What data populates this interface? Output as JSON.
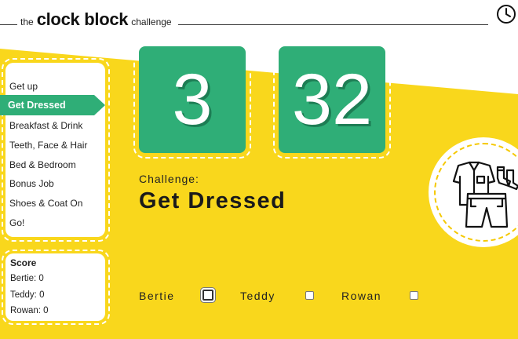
{
  "header": {
    "brand_prefix": "the",
    "brand_main": "clock block",
    "brand_suffix": "challenge",
    "clock_icon": "clock-icon"
  },
  "colors": {
    "yellow": "#f9d71c",
    "green": "#2fae77",
    "green_shadow": "#1d7d54",
    "white": "#ffffff"
  },
  "menu": {
    "items": [
      {
        "label": "Get up",
        "active": false
      },
      {
        "label": "Get Dressed",
        "active": true
      },
      {
        "label": "Breakfast & Drink",
        "active": false
      },
      {
        "label": "Teeth, Face & Hair",
        "active": false
      },
      {
        "label": "Bed & Bedroom",
        "active": false
      },
      {
        "label": "Bonus Job",
        "active": false
      },
      {
        "label": "Shoes & Coat On",
        "active": false
      },
      {
        "label": "Go!",
        "active": false
      }
    ]
  },
  "score": {
    "title": "Score",
    "lines": [
      "Bertie: 0",
      "Teddy: 0",
      "Rowan: 0"
    ]
  },
  "timer": {
    "minutes": "3",
    "seconds": "32"
  },
  "challenge": {
    "label": "Challenge:",
    "name": "Get Dressed",
    "icon": "clothes-icon"
  },
  "kids": [
    {
      "name": "Bertie",
      "checked": false
    },
    {
      "name": "Teddy",
      "checked": false
    },
    {
      "name": "Rowan",
      "checked": false
    }
  ]
}
